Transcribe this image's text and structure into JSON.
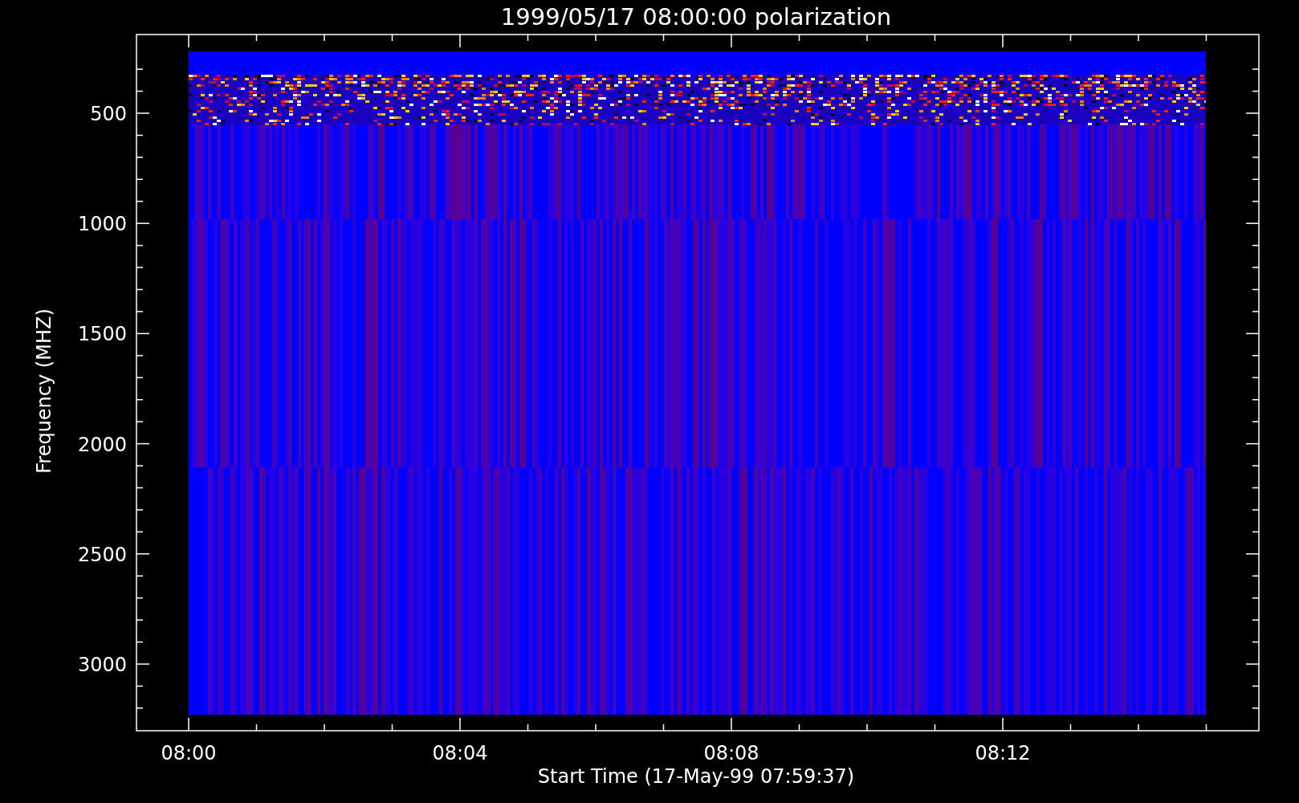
{
  "plot": {
    "title": "1999/05/17 08:00:00 polarization",
    "y_axis_label": "Frequency (MHZ)",
    "x_axis_label": "Start Time (17-May-99 07:59:37)",
    "y_tick_labels": [
      "500",
      "1000",
      "1500",
      "2000",
      "2500",
      "3000"
    ],
    "x_tick_labels": [
      "08:00",
      "08:04",
      "08:08",
      "08:12"
    ]
  }
}
